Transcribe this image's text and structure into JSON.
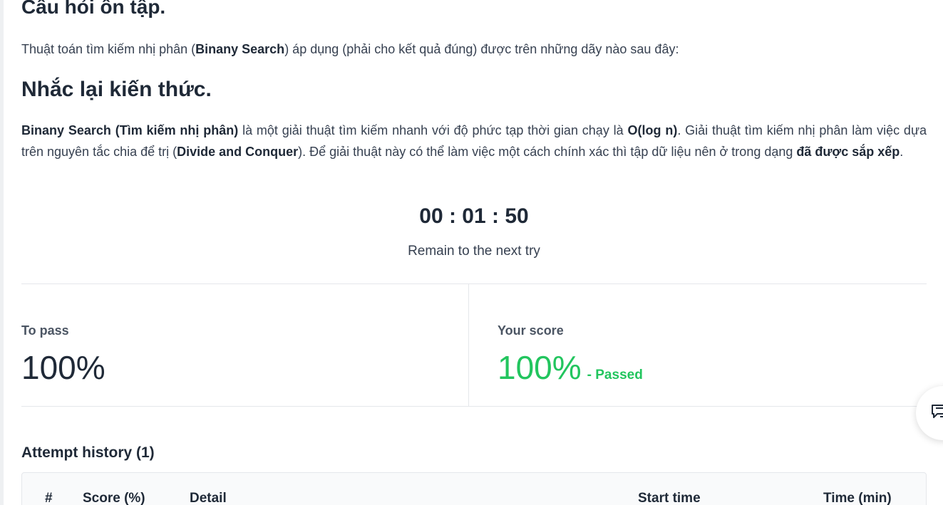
{
  "page": {
    "title": "Câu hỏi ôn tập.",
    "question": {
      "before": "Thuật toán tìm kiếm nhị phân (",
      "bold": "Binany Search",
      "after": ") áp dụng (phải cho kết quả đúng) được trên những dãy nào sau đây:"
    }
  },
  "knowledge": {
    "title": "Nhắc lại kiến thức.",
    "segments": [
      {
        "text": "Binany Search (Tìm kiếm nhị phân)",
        "bold": true
      },
      {
        "text": " là một giải thuật tìm kiếm nhanh với độ phức tạp thời gian chạy là ",
        "bold": false
      },
      {
        "text": "O(log n)",
        "bold": true
      },
      {
        "text": ". Giải thuật tìm kiếm nhị phân làm việc dựa trên nguyên tắc chia để trị (",
        "bold": false
      },
      {
        "text": "Divide and Conquer",
        "bold": true
      },
      {
        "text": "). Để giải thuật này có thể làm việc một cách chính xác thì tập dữ liệu nên ở trong dạng ",
        "bold": false
      },
      {
        "text": "đã được sắp xếp",
        "bold": true
      },
      {
        "text": ".",
        "bold": false
      }
    ]
  },
  "timer": {
    "value": "00 : 01 : 50",
    "caption": "Remain to the next try"
  },
  "stats": {
    "to_pass_label": "To pass",
    "to_pass_value": "100%",
    "score_label": "Your score",
    "score_value": "100%",
    "score_status": "- Passed",
    "pass_color": "#22c55e"
  },
  "history": {
    "title": "Attempt history (1)",
    "columns": [
      "#",
      "Score (%)",
      "Detail",
      "Start time",
      "Time (min)"
    ]
  },
  "fab": {
    "icon": "feedback-icon"
  }
}
